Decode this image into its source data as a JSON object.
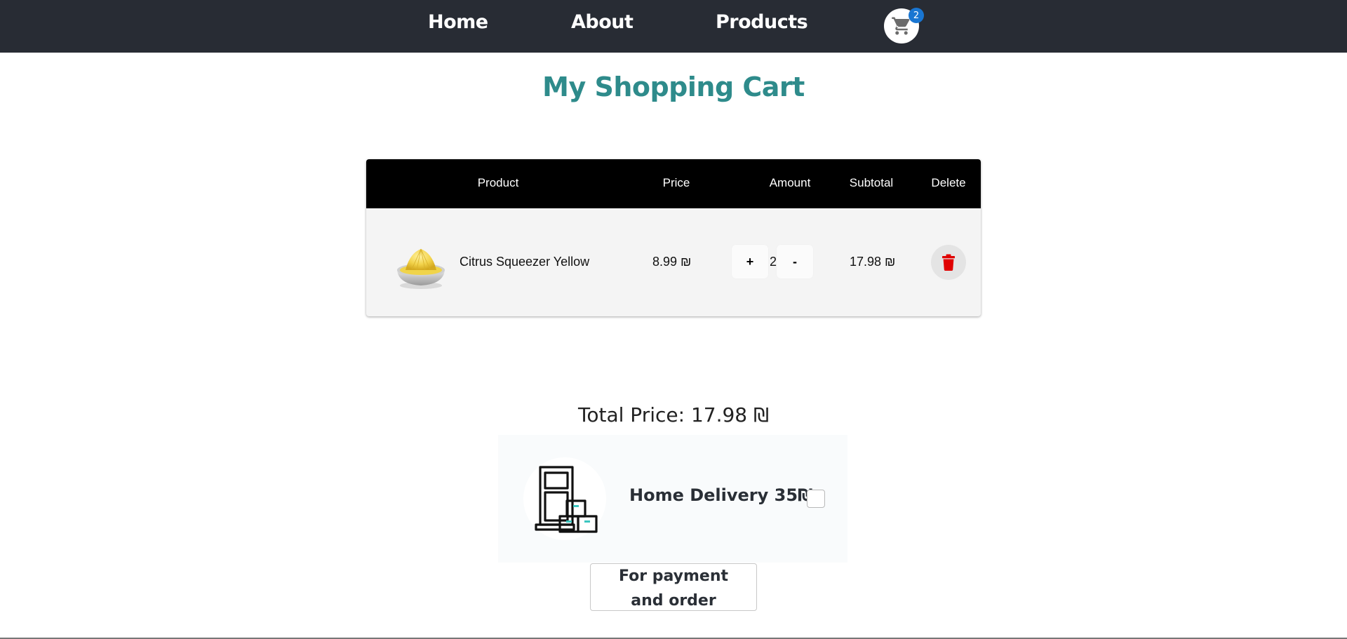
{
  "nav": {
    "home": "Home",
    "about": "About",
    "products": "Products",
    "cart_count": "2",
    "cart_icon": "shopping-cart-icon"
  },
  "page_title": "My Shopping Cart",
  "table": {
    "headers": [
      "Product",
      "Price",
      "Amount",
      "Subtotal",
      "Delete"
    ],
    "rows": [
      {
        "image_icon": "citrus-squeezer-image",
        "name": "Citrus Squeezer Yellow",
        "price": "8.99 ₪",
        "plus_label": "+",
        "amount": "2",
        "minus_label": "-",
        "subtotal": "17.98 ₪",
        "delete_icon": "trash-icon"
      }
    ]
  },
  "total": {
    "label": "Total Price: 17.98 ₪"
  },
  "delivery": {
    "label": "Home Delivery 35₪",
    "checked": false,
    "icon": "delivery-boxes-icon"
  },
  "pay_button": {
    "line1": "For payment",
    "line2": "and order"
  },
  "colors": {
    "navbar": "#282c34",
    "title": "#2e8b8b",
    "badge": "#1976d2",
    "delete": "#e00000"
  }
}
